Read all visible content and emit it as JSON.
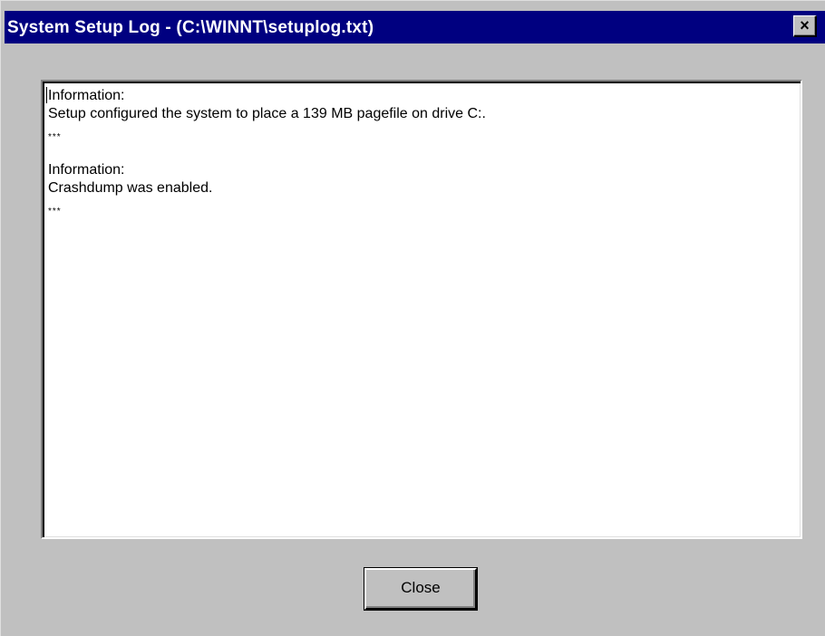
{
  "window": {
    "title": "System Setup Log - (C:\\WINNT\\setuplog.txt)",
    "close_glyph": "×"
  },
  "log": {
    "entries": [
      {
        "heading": "Information:",
        "message": "Setup configured the system to place a 139 MB pagefile on drive C:.",
        "separator": "***"
      },
      {
        "heading": "Information:",
        "message": "Crashdump was enabled.",
        "separator": "***"
      }
    ]
  },
  "footer": {
    "close_label": "Close"
  },
  "colors": {
    "titlebar": "#000080",
    "face": "#c0c0c0",
    "text_area": "#ffffff"
  }
}
